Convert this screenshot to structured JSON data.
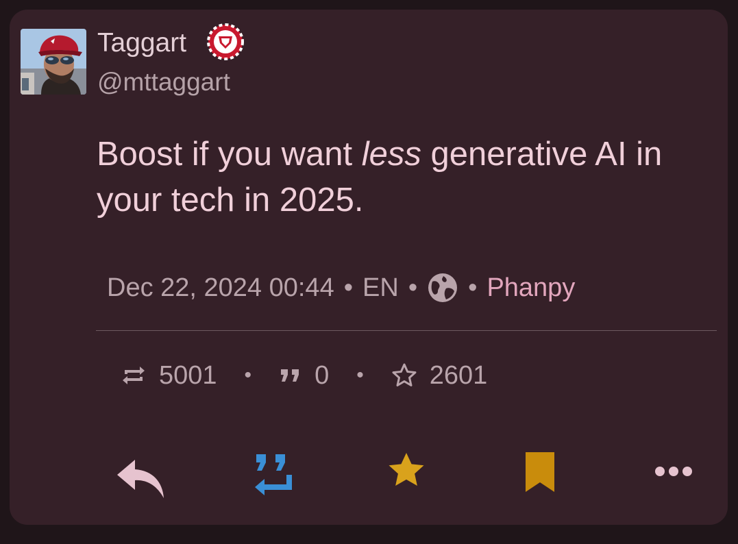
{
  "post": {
    "author": {
      "display_name": "Taggart",
      "handle": "@mttaggart",
      "avatar": "avatar",
      "badge_icon": "shield-badge-icon"
    },
    "content_before": "Boost if you want ",
    "content_emphasis": "less",
    "content_after": " generative AI in your tech in 2025.",
    "meta": {
      "datetime": "Dec 22, 2024 00:44",
      "language": "EN",
      "visibility_icon": "globe-icon",
      "client": "Phanpy",
      "separator": "•"
    },
    "stats": {
      "boosts": "5001",
      "quotes": "0",
      "favourites": "2601",
      "separator": "•"
    }
  },
  "actions": [
    {
      "name": "reply",
      "icon": "reply-icon"
    },
    {
      "name": "boost",
      "icon": "boost-icon"
    },
    {
      "name": "favourite",
      "icon": "star-icon"
    },
    {
      "name": "bookmark",
      "icon": "bookmark-icon"
    },
    {
      "name": "more",
      "icon": "more-icon"
    }
  ],
  "colors": {
    "background": "#1f1519",
    "card": "#352028",
    "text": "#f0cfd9",
    "muted": "#b9a4ab",
    "link": "#e2a6bd",
    "boost_active": "#3a8fd6",
    "favourite_active": "#d9a21c",
    "bookmark_active": "#c98c0c",
    "badge": "#c8192e"
  }
}
